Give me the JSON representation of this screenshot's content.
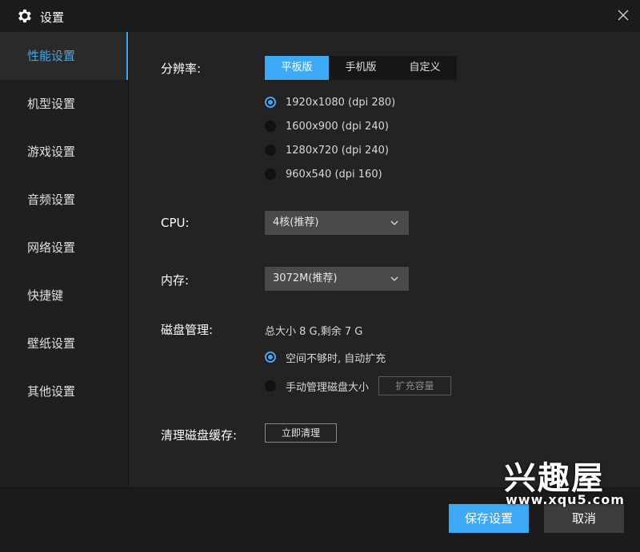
{
  "window": {
    "title": "设置"
  },
  "sidebar": {
    "items": [
      {
        "label": "性能设置",
        "active": true
      },
      {
        "label": "机型设置"
      },
      {
        "label": "游戏设置"
      },
      {
        "label": "音频设置"
      },
      {
        "label": "网络设置"
      },
      {
        "label": "快捷键"
      },
      {
        "label": "壁纸设置"
      },
      {
        "label": "其他设置"
      }
    ]
  },
  "resolution": {
    "label": "分辨率:",
    "tabs": [
      {
        "label": "平板版",
        "active": true
      },
      {
        "label": "手机版"
      },
      {
        "label": "自定义"
      }
    ],
    "options": [
      {
        "label": "1920x1080  (dpi 280)",
        "selected": true
      },
      {
        "label": "1600x900  (dpi 240)"
      },
      {
        "label": "1280x720  (dpi 240)"
      },
      {
        "label": "960x540  (dpi 160)"
      }
    ]
  },
  "cpu": {
    "label": "CPU:",
    "value": "4核(推荐)"
  },
  "memory": {
    "label": "内存:",
    "value": "3072M(推荐)"
  },
  "disk": {
    "label": "磁盘管理:",
    "info": "总大小 8 G,剩余 7 G",
    "options": [
      {
        "label": "空间不够时, 自动扩充",
        "selected": true
      },
      {
        "label": "手动管理磁盘大小"
      }
    ],
    "expand_button": "扩充容量"
  },
  "cache": {
    "label": "清理磁盘缓存:",
    "button": "立即清理"
  },
  "footer": {
    "save": "保存设置",
    "cancel": "取消"
  },
  "watermark": {
    "logo": "兴趣屋",
    "url": "www.xqu5.com"
  },
  "colors": {
    "accent": "#3ea9f5",
    "background": "#232323",
    "sidebar": "#1f1f1f"
  }
}
